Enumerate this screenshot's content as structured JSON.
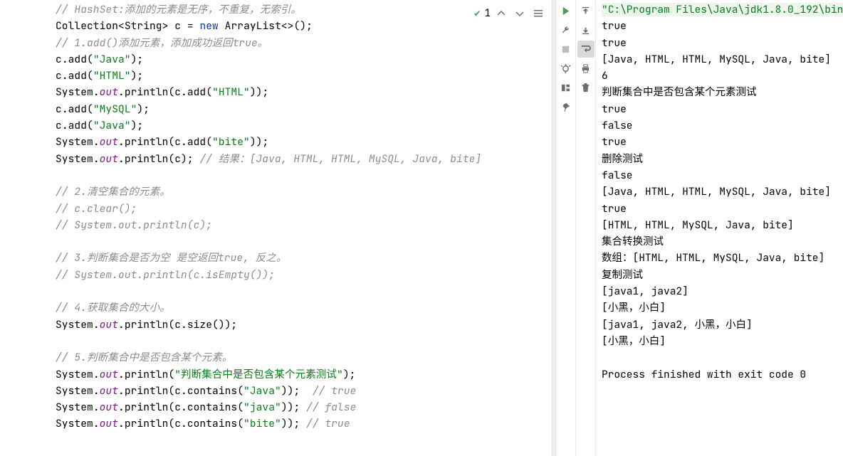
{
  "editor": {
    "inspection": {
      "count": "1"
    },
    "lines": [
      {
        "type": "comment",
        "text": "// HashSet:添加的元素是无序，不重复，无索引。"
      },
      {
        "type": "code",
        "tokens": [
          {
            "t": "type",
            "v": "Collection"
          },
          {
            "t": "punc",
            "v": "<"
          },
          {
            "t": "type",
            "v": "String"
          },
          {
            "t": "punc",
            "v": "> "
          },
          {
            "t": "ident",
            "v": "c"
          },
          {
            "t": "punc",
            "v": " = "
          },
          {
            "t": "kw",
            "v": "new"
          },
          {
            "t": "punc",
            "v": " "
          },
          {
            "t": "type",
            "v": "ArrayList"
          },
          {
            "t": "punc",
            "v": "<>();"
          }
        ]
      },
      {
        "type": "comment",
        "text": "// 1.add()添加元素，添加成功返回true。"
      },
      {
        "type": "code",
        "tokens": [
          {
            "t": "ident",
            "v": "c"
          },
          {
            "t": "punc",
            "v": ".add("
          },
          {
            "t": "str",
            "v": "\"Java\""
          },
          {
            "t": "punc",
            "v": ");"
          }
        ]
      },
      {
        "type": "code",
        "tokens": [
          {
            "t": "ident",
            "v": "c"
          },
          {
            "t": "punc",
            "v": ".add("
          },
          {
            "t": "str",
            "v": "\"HTML\""
          },
          {
            "t": "punc",
            "v": ");"
          }
        ]
      },
      {
        "type": "code",
        "tokens": [
          {
            "t": "type",
            "v": "System"
          },
          {
            "t": "punc",
            "v": "."
          },
          {
            "t": "field",
            "v": "out"
          },
          {
            "t": "punc",
            "v": ".println(c.add("
          },
          {
            "t": "str",
            "v": "\"HTML\""
          },
          {
            "t": "punc",
            "v": "));"
          }
        ]
      },
      {
        "type": "code",
        "tokens": [
          {
            "t": "ident",
            "v": "c"
          },
          {
            "t": "punc",
            "v": ".add("
          },
          {
            "t": "str",
            "v": "\"MySQL\""
          },
          {
            "t": "punc",
            "v": ");"
          }
        ]
      },
      {
        "type": "code",
        "tokens": [
          {
            "t": "ident",
            "v": "c"
          },
          {
            "t": "punc",
            "v": ".add("
          },
          {
            "t": "str",
            "v": "\"Java\""
          },
          {
            "t": "punc",
            "v": ");"
          }
        ]
      },
      {
        "type": "code",
        "tokens": [
          {
            "t": "type",
            "v": "System"
          },
          {
            "t": "punc",
            "v": "."
          },
          {
            "t": "field",
            "v": "out"
          },
          {
            "t": "punc",
            "v": ".println(c.add("
          },
          {
            "t": "str",
            "v": "\"bite\""
          },
          {
            "t": "punc",
            "v": "));"
          }
        ]
      },
      {
        "type": "code",
        "tokens": [
          {
            "t": "type",
            "v": "System"
          },
          {
            "t": "punc",
            "v": "."
          },
          {
            "t": "field",
            "v": "out"
          },
          {
            "t": "punc",
            "v": ".println(c); "
          },
          {
            "t": "comment",
            "v": "// 结果：[Java, HTML, HTML, MySQL, Java, bite]"
          }
        ]
      },
      {
        "type": "blank"
      },
      {
        "type": "comment",
        "text": "// 2.清空集合的元素。"
      },
      {
        "type": "comment",
        "text": "// c.clear();"
      },
      {
        "type": "comment",
        "text": "// System.out.println(c);"
      },
      {
        "type": "blank"
      },
      {
        "type": "comment",
        "text": "// 3.判断集合是否为空 是空返回true, 反之。"
      },
      {
        "type": "comment",
        "text": "// System.out.println(c.isEmpty());"
      },
      {
        "type": "blank"
      },
      {
        "type": "comment",
        "text": "// 4.获取集合的大小。"
      },
      {
        "type": "code",
        "tokens": [
          {
            "t": "type",
            "v": "System"
          },
          {
            "t": "punc",
            "v": "."
          },
          {
            "t": "field",
            "v": "out"
          },
          {
            "t": "punc",
            "v": ".println(c.size());"
          }
        ]
      },
      {
        "type": "blank"
      },
      {
        "type": "comment",
        "text": "// 5.判断集合中是否包含某个元素。"
      },
      {
        "type": "code",
        "tokens": [
          {
            "t": "type",
            "v": "System"
          },
          {
            "t": "punc",
            "v": "."
          },
          {
            "t": "field",
            "v": "out"
          },
          {
            "t": "punc",
            "v": ".println("
          },
          {
            "t": "str",
            "v": "\"判断集合中是否包含某个元素测试\""
          },
          {
            "t": "punc",
            "v": ");"
          }
        ]
      },
      {
        "type": "code",
        "tokens": [
          {
            "t": "type",
            "v": "System"
          },
          {
            "t": "punc",
            "v": "."
          },
          {
            "t": "field",
            "v": "out"
          },
          {
            "t": "punc",
            "v": ".println(c.contains("
          },
          {
            "t": "str",
            "v": "\"Java\""
          },
          {
            "t": "punc",
            "v": "));  "
          },
          {
            "t": "comment",
            "v": "// true"
          }
        ]
      },
      {
        "type": "code",
        "tokens": [
          {
            "t": "type",
            "v": "System"
          },
          {
            "t": "punc",
            "v": "."
          },
          {
            "t": "field",
            "v": "out"
          },
          {
            "t": "punc",
            "v": ".println(c.contains("
          },
          {
            "t": "str",
            "v": "\"java\""
          },
          {
            "t": "punc",
            "v": ")); "
          },
          {
            "t": "comment",
            "v": "// false"
          }
        ]
      },
      {
        "type": "code",
        "tokens": [
          {
            "t": "type",
            "v": "System"
          },
          {
            "t": "punc",
            "v": "."
          },
          {
            "t": "field",
            "v": "out"
          },
          {
            "t": "punc",
            "v": ".println(c.contains("
          },
          {
            "t": "str",
            "v": "\"bite\""
          },
          {
            "t": "punc",
            "v": ")); "
          },
          {
            "t": "comment",
            "v": "// true"
          }
        ]
      }
    ]
  },
  "console": {
    "path": "\"C:\\Program Files\\Java\\jdk1.8.0_192\\bin",
    "lines": [
      "true",
      "true",
      "[Java, HTML, HTML, MySQL, Java, bite]",
      "6",
      "判断集合中是否包含某个元素测试",
      "true",
      "false",
      "true",
      "删除测试",
      "false",
      "[Java, HTML, HTML, MySQL, Java, bite]",
      "true",
      "[HTML, HTML, MySQL, Java, bite]",
      "集合转换测试",
      "数组：[HTML, HTML, MySQL, Java, bite]",
      "复制测试",
      "[java1, java2]",
      "[小黑，小白]",
      "[java1, java2, 小黑，小白]",
      "[小黑，小白]",
      "",
      "Process finished with exit code 0"
    ]
  }
}
